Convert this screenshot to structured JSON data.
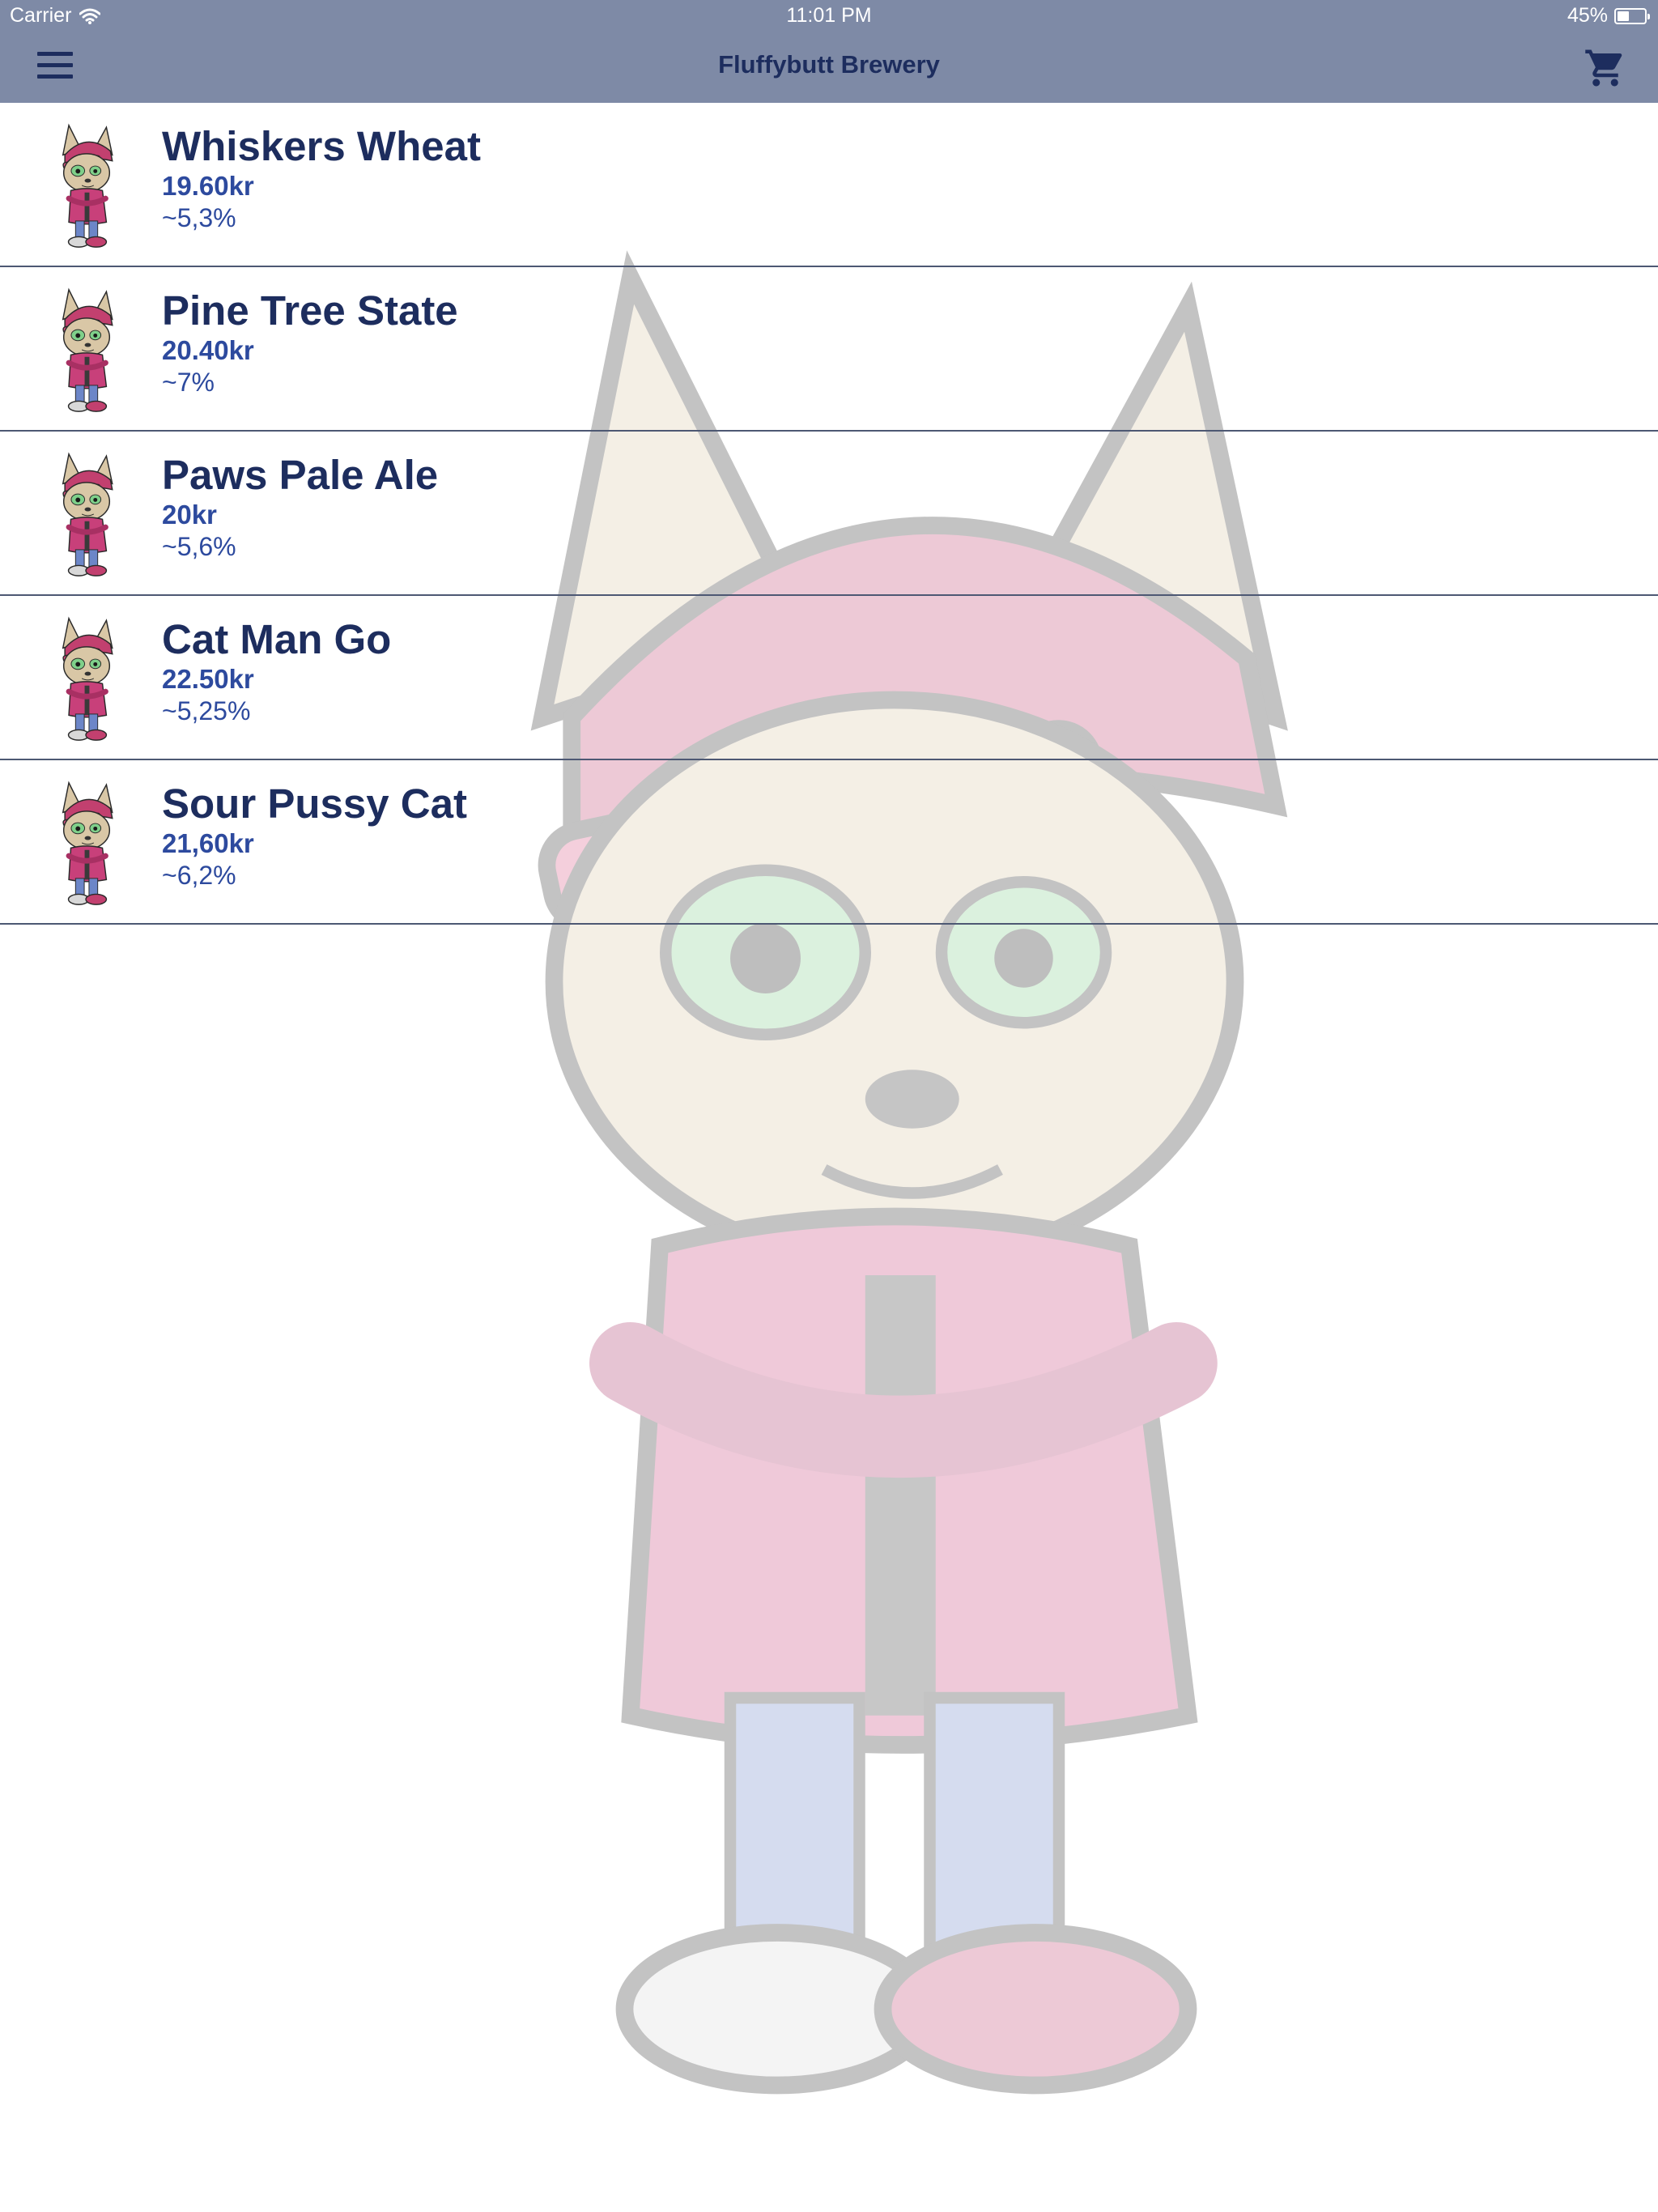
{
  "status_bar": {
    "carrier": "Carrier",
    "time": "11:01 PM",
    "battery": "45%",
    "battery_level": 0.45
  },
  "nav": {
    "title": "Fluffybutt Brewery",
    "menu_icon": "hamburger-menu-icon",
    "cart_icon": "shopping-cart-icon"
  },
  "colors": {
    "nav_background": "#7e8aa6",
    "title_text": "#1d2d5e",
    "price_text": "#2d4a9e",
    "divider": "#4d5873"
  },
  "beers": [
    {
      "name": "Whiskers Wheat",
      "price": "19.60kr",
      "abv": "~5,3%"
    },
    {
      "name": "Pine Tree State",
      "price": "20.40kr",
      "abv": "~7%"
    },
    {
      "name": "Paws Pale Ale",
      "price": "20kr",
      "abv": "~5,6%"
    },
    {
      "name": "Cat Man Go",
      "price": "22.50kr",
      "abv": "~5,25%"
    },
    {
      "name": "Sour Pussy Cat",
      "price": "21,60kr",
      "abv": "~6,2%"
    }
  ]
}
